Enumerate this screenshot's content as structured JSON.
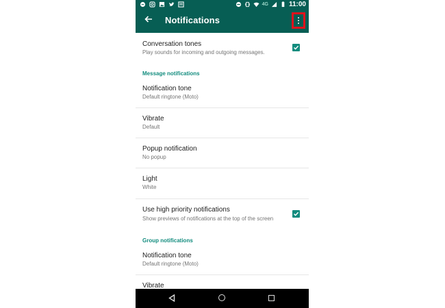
{
  "status_bar": {
    "time": "11:00",
    "network": "4G",
    "left_icons": [
      "chat-icon",
      "instagram-icon",
      "gallery-icon",
      "twitter-icon",
      "news-icon"
    ],
    "right_icons": [
      "do-not-disturb-icon",
      "vibrate-icon",
      "wifi-icon",
      "signal-icon",
      "battery-icon"
    ]
  },
  "app_bar": {
    "title": "Notifications"
  },
  "settings": {
    "conversation_tones": {
      "title": "Conversation tones",
      "summary": "Play sounds for incoming and outgoing messages.",
      "checked": true
    },
    "message_section": "Message notifications",
    "message": {
      "tone": {
        "title": "Notification tone",
        "summary": "Default ringtone (Moto)"
      },
      "vibrate": {
        "title": "Vibrate",
        "summary": "Default"
      },
      "popup": {
        "title": "Popup notification",
        "summary": "No popup"
      },
      "light": {
        "title": "Light",
        "summary": "White"
      },
      "high_priority": {
        "title": "Use high priority notifications",
        "summary": "Show previews of notifications at the top of the screen",
        "checked": true
      }
    },
    "group_section": "Group notifications",
    "group": {
      "tone": {
        "title": "Notification tone",
        "summary": "Default ringtone (Moto)"
      },
      "vibrate": {
        "title": "Vibrate"
      }
    }
  },
  "colors": {
    "primary_dark": "#075e54",
    "accent": "#128c7e",
    "highlight_box": "#e8121c"
  }
}
